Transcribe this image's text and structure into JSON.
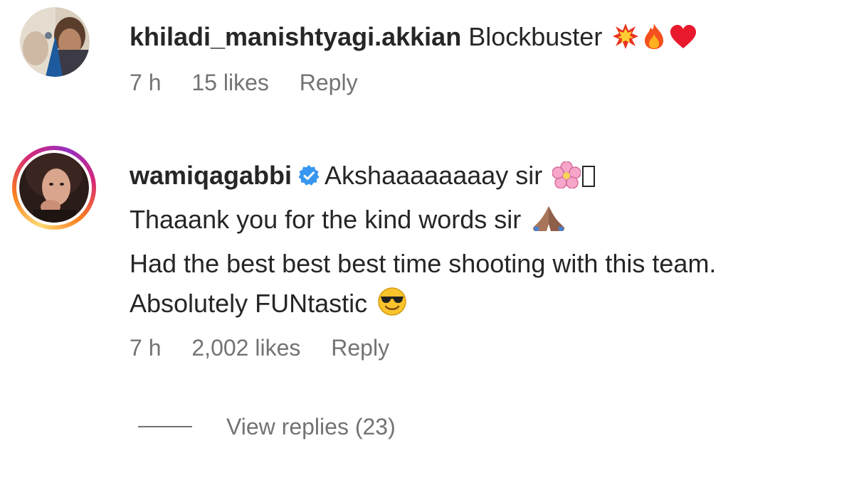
{
  "comments": [
    {
      "username": "khiladi_manishtyagi.akkian",
      "lines": [
        "Blockbuster"
      ],
      "emoji": [
        "collision-emoji",
        "fire-emoji",
        "red-heart-emoji"
      ],
      "time": "7 h",
      "likes": "15 likes",
      "reply_label": "Reply",
      "verified": false
    },
    {
      "username": "wamiqagabbi",
      "lines": [
        "Akshaaaaaaaay sir",
        "Thaaank you for the kind words sir",
        "Had the best best best time shooting with this team.",
        "Absolutely FUNtastic"
      ],
      "emoji": [
        "cherry-blossom-emoji",
        "missing-glyph",
        "folded-hands-emoji",
        "smiling-face-with-sunglasses-emoji"
      ],
      "time": "7 h",
      "likes": "2,002 likes",
      "reply_label": "Reply",
      "verified": true,
      "story_ring_colors": [
        "#feda75",
        "#fa7e1e",
        "#d62976",
        "#962fbf"
      ]
    }
  ],
  "view_replies": {
    "label": "View replies (23)"
  },
  "colors": {
    "text": "#262626",
    "secondary": "#737373",
    "verified": "#3897f0"
  }
}
